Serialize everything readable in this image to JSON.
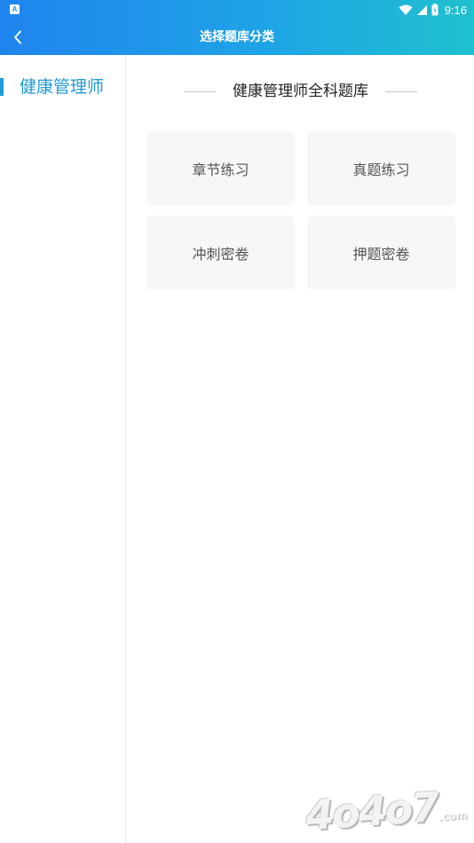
{
  "status_bar": {
    "app_icon_letter": "A",
    "time": "9:16"
  },
  "header": {
    "title": "选择题库分类"
  },
  "sidebar": {
    "items": [
      {
        "label": "健康管理师",
        "active": true
      }
    ]
  },
  "main": {
    "section_title": "健康管理师全科题库",
    "cards": [
      {
        "label": "章节练习"
      },
      {
        "label": "真题练习"
      },
      {
        "label": "冲刺密卷"
      },
      {
        "label": "押题密卷"
      }
    ]
  },
  "watermark": {
    "text": "4o4o7",
    "suffix": ".com"
  },
  "colors": {
    "header_start": "#1f84ee",
    "header_end": "#1fc0cf",
    "accent": "#1e9ad9",
    "card_bg": "#f7f7f7"
  }
}
